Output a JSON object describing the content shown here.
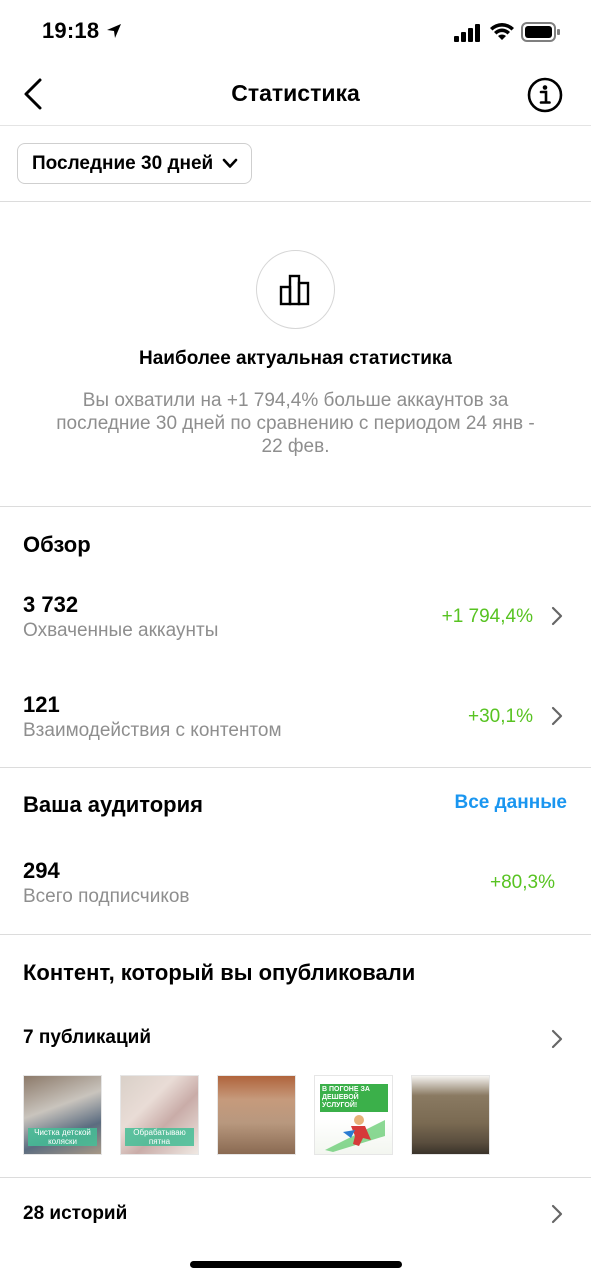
{
  "status_bar": {
    "time": "19:18"
  },
  "nav": {
    "title": "Статистика"
  },
  "period": {
    "label": "Последние 30 дней"
  },
  "hero": {
    "title": "Наиболее актуальная статистика",
    "description": "Вы охватили на +1 794,4% больше аккаунтов за последние 30 дней по сравнению с периодом 24 янв - 22 фев."
  },
  "overview": {
    "title": "Обзор",
    "metrics": [
      {
        "value": "3 732",
        "label": "Охваченные аккаунты",
        "change": "+1 794,4%"
      },
      {
        "value": "121",
        "label": "Взаимодействия с контентом",
        "change": "+30,1%"
      }
    ]
  },
  "audience": {
    "title": "Ваша аудитория",
    "link": "Все данные",
    "value": "294",
    "label": "Всего подписчиков",
    "change": "+80,3%"
  },
  "content": {
    "title": "Контент, который вы опубликовали",
    "publications_label": "7 публикаций",
    "thumbnails": [
      {
        "caption": "Чистка детской коляски"
      },
      {
        "caption": "Обрабатываю пятна"
      },
      {
        "caption": ""
      },
      {
        "caption": "В ПОГОНЕ ЗА ДЕШЕВОЙ УСЛУГОЙ!"
      },
      {
        "caption": ""
      }
    ],
    "stories_label": "28 историй"
  },
  "colors": {
    "positive": "#58c322",
    "link": "#1a96f0",
    "secondary_text": "#8e8e8e"
  }
}
